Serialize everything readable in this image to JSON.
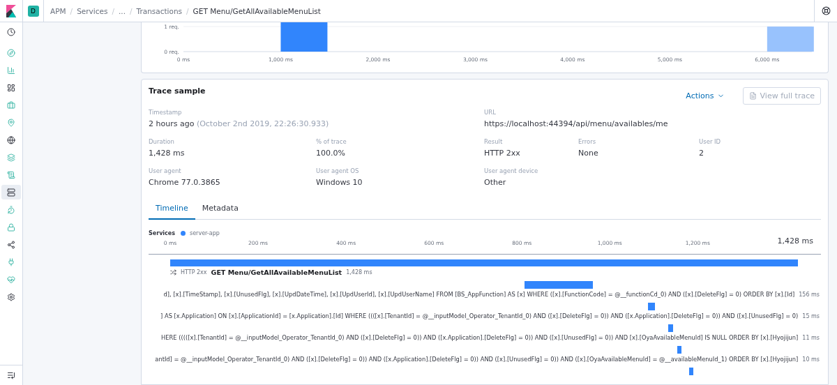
{
  "header": {
    "space_initial": "D",
    "separator": "/",
    "breadcrumbs": [
      {
        "label": "APM",
        "current": false
      },
      {
        "label": "Services",
        "current": false
      },
      {
        "label": "...",
        "current": false
      },
      {
        "label": "Transactions",
        "current": false
      },
      {
        "label": "GET Menu/GetAllAvailableMenuList",
        "current": true
      }
    ]
  },
  "nav_items": [
    {
      "selected": false
    },
    {
      "selected": false
    },
    {
      "selected": false
    },
    {
      "selected": false
    },
    {
      "selected": false
    },
    {
      "selected": false
    },
    {
      "selected": false
    },
    {
      "selected": false
    },
    {
      "selected": false
    },
    {
      "selected": true
    },
    {
      "selected": false
    },
    {
      "selected": false
    },
    {
      "selected": false
    },
    {
      "selected": false
    },
    {
      "selected": false
    },
    {
      "selected": false
    }
  ],
  "distribution": {
    "chart_data": {
      "type": "bar",
      "x": [
        1000,
        6000
      ],
      "series": [
        {
          "color": "#3185fc",
          "values": [
            1.17,
            null
          ]
        },
        {
          "color": "#98c2fd",
          "values": [
            null,
            1
          ]
        }
      ],
      "xlim": [
        0,
        6460
      ],
      "ylim": [
        0,
        1.17
      ],
      "xticks": [
        {
          "value": 0,
          "label": "0 ms"
        },
        {
          "value": 1000,
          "label": "1,000 ms"
        },
        {
          "value": 2000,
          "label": "2,000 ms"
        },
        {
          "value": 3000,
          "label": "3,000 ms"
        },
        {
          "value": 4000,
          "label": "4,000 ms"
        },
        {
          "value": 5000,
          "label": "5,000 ms"
        },
        {
          "value": 6000,
          "label": "6,000 ms"
        }
      ],
      "yticks": [
        {
          "value": 0,
          "label": "0 req."
        },
        {
          "value": 1,
          "label": "1 req."
        }
      ]
    }
  },
  "trace_sample": {
    "title": "Trace sample",
    "actions": "Actions",
    "view_full_trace": {
      "label": "View full trace",
      "disabled": true
    },
    "fields": [
      [
        {
          "label": "Timestamp",
          "value": "2 hours ago",
          "note": "(October 2nd 2019, 22:26:30.933)"
        },
        {
          "label": "URL",
          "value": "https://localhost:44394/api/menu/availables/me"
        }
      ],
      [
        {
          "label": "Duration",
          "value": "1,428 ms"
        },
        {
          "label": "% of trace",
          "value": "100.0%"
        },
        {
          "label": "Result",
          "value": "HTTP 2xx"
        },
        {
          "label": "Errors",
          "value": "None"
        },
        {
          "label": "User ID",
          "value": "2"
        }
      ],
      [
        {
          "label": "User agent",
          "value": "Chrome 77.0.3865"
        },
        {
          "label": "User agent OS",
          "value": "Windows 10"
        },
        {
          "label": "User agent device",
          "value": "Other"
        }
      ]
    ],
    "tabs": [
      {
        "label": "Timeline",
        "selected": true
      },
      {
        "label": "Metadata",
        "selected": false
      }
    ],
    "services_label": "Services",
    "services": [
      {
        "name": "server-app",
        "color": "#3185fc"
      }
    ],
    "total": "1,428 ms",
    "ticks": [
      "0 ms",
      "200 ms",
      "400 ms",
      "600 ms",
      "800 ms",
      "1,000 ms",
      "1,200 ms"
    ],
    "root": {
      "result": "HTTP 2xx",
      "name": "GET Menu/GetAllAvailableMenuList",
      "duration": "1,428 ms"
    },
    "spans": [
      {
        "text": "d], [x].[TimeStamp], [x].[UnusedFlg], [x].[UpdDateTime], [x].[UpdUserId], [x].[UpdUserName] FROM [BS_AppFunction] AS [x] WHERE ([x].[FunctionCode] = @__functionCd_0) AND ([x].[DeleteFlg] = 0) ORDER BY [x].[Id]",
        "duration": "156 ms"
      },
      {
        "text": "] AS [x.Application] ON [x].[ApplicationId] = [x.Application].[Id] WHERE ((([x].[TenantId] = @__inputModel_Operator_TenantId_0) AND ([x].[DeleteFlg] = 0)) AND ([x.Application].[DeleteFlg] = 0)) AND ([x].[UnusedFlg] = 0)",
        "duration": "15 ms"
      },
      {
        "text": "HERE (((([x].[TenantId] = @__inputModel_Operator_TenantId_0) AND ([x].[DeleteFlg] = 0)) AND ([x.Application].[DeleteFlg] = 0)) AND ([x].[UnusedFlg] = 0)) AND [x].[OyaAvailableMenuId] IS NULL ORDER BY [x].[Hyojijun]",
        "duration": "11 ms"
      },
      {
        "text": "antId] = @__inputModel_Operator_TenantId_0) AND ([x].[DeleteFlg] = 0)) AND ([x.Application].[DeleteFlg] = 0)) AND ([x].[UnusedFlg] = 0)) AND ([x].[OyaAvailableMenuId] = @__availableMenuId_1) ORDER BY [x].[Hyojijun]",
        "duration": "10 ms"
      }
    ]
  }
}
